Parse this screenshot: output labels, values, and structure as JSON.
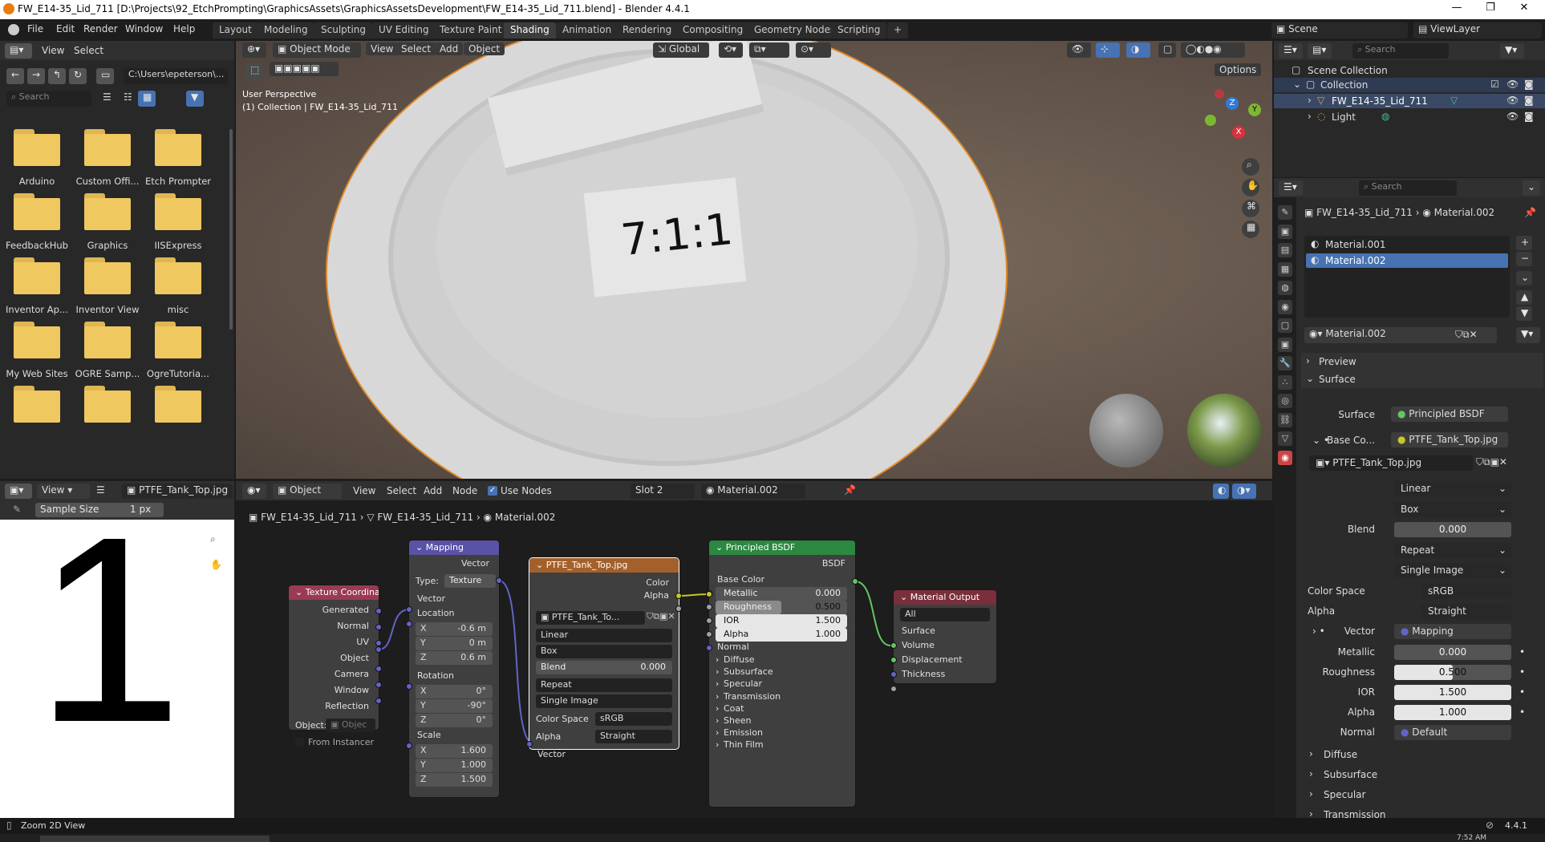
{
  "window": {
    "title": "FW_E14-35_Lid_711 [D:\\Projects\\92_EtchPrompting\\GraphicsAssets\\GraphicsAssetsDevelopment\\FW_E14-35_Lid_711.blend] - Blender 4.4.1",
    "minimize": "—",
    "maximize": "❐",
    "close": "✕"
  },
  "menu": [
    "File",
    "Edit",
    "Render",
    "Window",
    "Help"
  ],
  "workspaces": [
    "Layout",
    "Modeling",
    "Sculpting",
    "UV Editing",
    "Texture Paint",
    "Shading",
    "Animation",
    "Rendering",
    "Compositing",
    "Geometry Nodes",
    "Scripting"
  ],
  "active_workspace": "Shading",
  "scene": {
    "name": "Scene",
    "view_layer": "ViewLayer"
  },
  "file_browser": {
    "menus": [
      "View",
      "Select"
    ],
    "path": "C:\\Users\\epeterson\\...",
    "search_placeholder": "Search",
    "folders": [
      "Arduino",
      "Custom Offi...",
      "Etch Prompter",
      "FeedbackHub",
      "Graphics",
      "IISExpress",
      "Inventor Ap...",
      "Inventor View",
      "misc",
      "My Web Sites",
      "OGRE Samp...",
      "OgreTutoria..."
    ]
  },
  "viewport": {
    "mode": "Object Mode",
    "menus": [
      "View",
      "Select",
      "Add",
      "Object"
    ],
    "transform": "Global",
    "options": "Options",
    "perspective": "User Perspective",
    "collection": "(1) Collection | FW_E14-35_Lid_711",
    "etched_text": "7:1:1",
    "gizmo": {
      "x": "X",
      "y": "Y",
      "z": "Z"
    }
  },
  "image_editor": {
    "view": "View",
    "image": "PTFE_Tank_Top.jpg",
    "sample_label": "Sample Size",
    "sample_value": "1 px",
    "big_glyph": "1"
  },
  "node_editor": {
    "type": "Object",
    "menus": [
      "View",
      "Select",
      "Add",
      "Node"
    ],
    "use_nodes": "Use Nodes",
    "slot": "Slot 2",
    "material": "Material.002",
    "breadcrumb": [
      "FW_E14-35_Lid_711",
      "FW_E14-35_Lid_711",
      "Material.002"
    ],
    "texcoord": {
      "title": "Texture Coordinate",
      "outputs": [
        "Generated",
        "Normal",
        "UV",
        "Object",
        "Camera",
        "Window",
        "Reflection"
      ],
      "object_label": "Object:",
      "object_placeholder": "Objec",
      "instancer": "From Instancer"
    },
    "mapping": {
      "title": "Mapping",
      "vector_out": "Vector",
      "type_label": "Type:",
      "type": "Texture",
      "vector_in": "Vector",
      "location": "Location",
      "loc": [
        [
          "X",
          "-0.6 m"
        ],
        [
          "Y",
          "0 m"
        ],
        [
          "Z",
          "0.6 m"
        ]
      ],
      "rotation": "Rotation",
      "rot": [
        [
          "X",
          "0°"
        ],
        [
          "Y",
          "-90°"
        ],
        [
          "Z",
          "0°"
        ]
      ],
      "scale": "Scale",
      "scl": [
        [
          "X",
          "1.600"
        ],
        [
          "Y",
          "1.000"
        ],
        [
          "Z",
          "1.500"
        ]
      ]
    },
    "image": {
      "title": "PTFE_Tank_Top.jpg",
      "color": "Color",
      "alpha": "Alpha",
      "img_name": "PTFE_Tank_To...",
      "interp": "Linear",
      "proj": "Box",
      "blend_label": "Blend",
      "blend": "0.000",
      "extension": "Repeat",
      "source": "Single Image",
      "colorspace_label": "Color Space",
      "colorspace": "sRGB",
      "alpha_label": "Alpha",
      "alpha_mode": "Straight",
      "vector": "Vector"
    },
    "bsdf": {
      "title": "Principled BSDF",
      "out": "BSDF",
      "base_color": "Base Color",
      "fields": [
        [
          "Metallic",
          "0.000",
          0
        ],
        [
          "Roughness",
          "0.500",
          0.5
        ],
        [
          "IOR",
          "1.500",
          1
        ],
        [
          "Alpha",
          "1.000",
          1
        ]
      ],
      "normal": "Normal",
      "panels": [
        "Diffuse",
        "Subsurface",
        "Specular",
        "Transmission",
        "Coat",
        "Sheen",
        "Emission",
        "Thin Film"
      ]
    },
    "output": {
      "title": "Material Output",
      "target": "All",
      "inputs": [
        "Surface",
        "Volume",
        "Displacement",
        "Thickness"
      ]
    }
  },
  "outliner": {
    "search_placeholder": "Search",
    "scene_collection": "Scene Collection",
    "collection": "Collection",
    "object": "FW_E14-35_Lid_711",
    "light": "Light"
  },
  "properties": {
    "search_placeholder": "Search",
    "object": "FW_E14-35_Lid_711",
    "material": "Material.002",
    "slots": [
      "Material.001",
      "Material.002"
    ],
    "material_name": "Material.002",
    "preview": "Preview",
    "surface_panel": "Surface",
    "surface_label": "Surface",
    "surface_value": "Principled BSDF",
    "basecolor_label": "Base Co...",
    "basecolor_value": "PTFE_Tank_Top.jpg",
    "image_name": "PTFE_Tank_Top.jpg",
    "interp": "Linear",
    "proj": "Box",
    "blend_label": "Blend",
    "blend": "0.000",
    "extension": "Repeat",
    "source": "Single Image",
    "colorspace_label": "Color Space",
    "colorspace": "sRGB",
    "alpha_label": "Alpha",
    "alpha_mode": "Straight",
    "vector_label": "Vector",
    "vector_value": "Mapping",
    "metallic_label": "Metallic",
    "metallic": "0.000",
    "roughness_label": "Roughness",
    "roughness": "0.500",
    "ior_label": "IOR",
    "ior": "1.500",
    "alpha2_label": "Alpha",
    "alpha2": "1.000",
    "normal_label": "Normal",
    "normal_value": "Default",
    "subpanels": [
      "Diffuse",
      "Subsurface",
      "Specular",
      "Transmission"
    ]
  },
  "statusbar": {
    "hint": "Zoom 2D View",
    "version": "4.4.1",
    "clock": "7:52 AM"
  },
  "colors": {
    "texcoord_header": "#9a3a54",
    "mapping_header": "#5a52a6",
    "image_header": "#a4602a",
    "bsdf_header": "#2c8840",
    "output_header": "#7a2f3c",
    "selection": "#4772b3",
    "socket_vector": "#6363c7",
    "socket_color": "#c7c729",
    "socket_float": "#a1a1a1",
    "socket_shader": "#63c763"
  }
}
